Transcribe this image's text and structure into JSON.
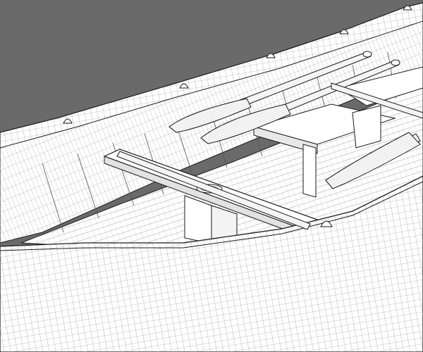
{
  "render": {
    "background": "#6a6a6a",
    "fill": "#ffffff",
    "line": "#1a1a1a",
    "wire": "#7a7a7a",
    "shadow": "#c9c9c9",
    "oar_count": 3,
    "thole_count": 8
  }
}
